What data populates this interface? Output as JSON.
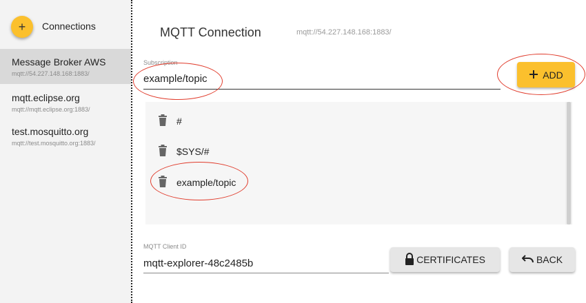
{
  "sidebar": {
    "add_label": "+",
    "title": "Connections",
    "items": [
      {
        "name": "Message Broker AWS",
        "url": "mqtt://54.227.148.168:1883/",
        "selected": true
      },
      {
        "name": "mqtt.eclipse.org",
        "url": "mqtt://mqtt.eclipse.org:1883/",
        "selected": false
      },
      {
        "name": "test.mosquitto.org",
        "url": "mqtt://test.mosquitto.org:1883/",
        "selected": false
      }
    ]
  },
  "main": {
    "title": "MQTT Connection",
    "url": "mqtt://54.227.148.168:1883/",
    "subscription": {
      "label": "Subscription",
      "value": "example/topic",
      "add_label": "ADD"
    },
    "topics": [
      "#",
      "$SYS/#",
      "example/topic"
    ],
    "client_id": {
      "label": "MQTT Client ID",
      "value": "mqtt-explorer-48c2485b"
    },
    "certificates_label": "CERTIFICATES",
    "back_label": "BACK"
  },
  "colors": {
    "accent": "#fbc02d",
    "annotation": "#e03a2a",
    "sidebar_bg": "#f3f3f3",
    "selected_bg": "#d9d9d9"
  },
  "icons": [
    "plus-icon",
    "trash-icon",
    "lock-icon",
    "undo-icon"
  ]
}
